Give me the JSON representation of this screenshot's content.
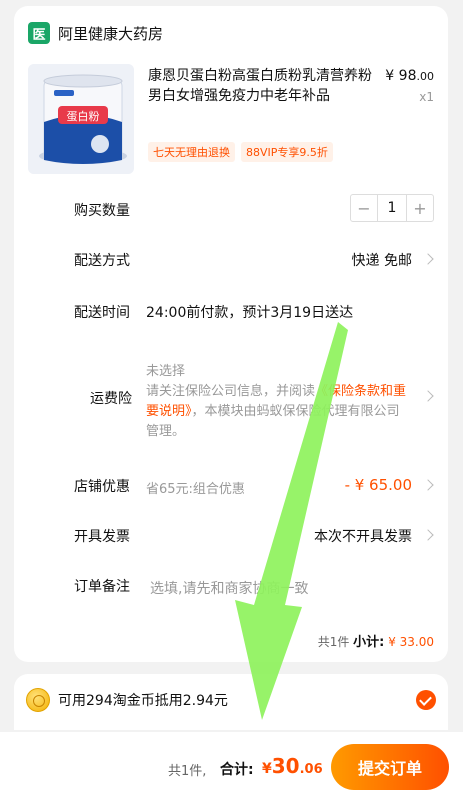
{
  "shop": {
    "logo_char": "医",
    "name": "阿里健康大药房"
  },
  "product": {
    "title": "康恩贝蛋白粉高蛋白质粉乳清营养粉男白女增强免疫力中老年补品",
    "price_symbol": "¥",
    "price_int": "98",
    "price_dec": ".00",
    "quantity_label": "x1",
    "tags": [
      "七天无理由退换",
      "88VIP专享9.5折"
    ],
    "image_text": "蛋白粉"
  },
  "rows": {
    "quantity": {
      "label": "购买数量",
      "minus": "−",
      "value": "1",
      "plus": "+"
    },
    "delivery": {
      "label": "配送方式",
      "value": "快递 免邮"
    },
    "delivery_time": {
      "label": "配送时间",
      "value": "24:00前付款，预计3月19日送达"
    },
    "insurance": {
      "label": "运费险",
      "status": "未选择",
      "text_before": "请关注保险公司信息，并阅读",
      "link": "《保险条款和重要说明》",
      "text_after": "，本模块由蚂蚁保保险代理有限公司管理。"
    },
    "shop_discount": {
      "label": "店铺优惠",
      "desc": "省65元:组合优惠",
      "value": "- ¥ 65.00"
    },
    "invoice": {
      "label": "开具发票",
      "value": "本次不开具发票"
    },
    "note": {
      "label": "订单备注",
      "placeholder": "选填,请先和商家协商一致"
    }
  },
  "subtotal": {
    "count": "共1件",
    "label": "小计:",
    "amount": "¥ 33.00"
  },
  "coin": {
    "text": "可用294淘金币抵用2.94元"
  },
  "footer": {
    "count": "共1件,",
    "total_label": "合计:",
    "symbol": "¥",
    "amount_int": "30",
    "amount_dec": ".06",
    "submit_label": "提交订单"
  },
  "colors": {
    "accent": "#ff5000",
    "brand_green": "#1aa667",
    "arrow_green": "#8ef25c"
  }
}
